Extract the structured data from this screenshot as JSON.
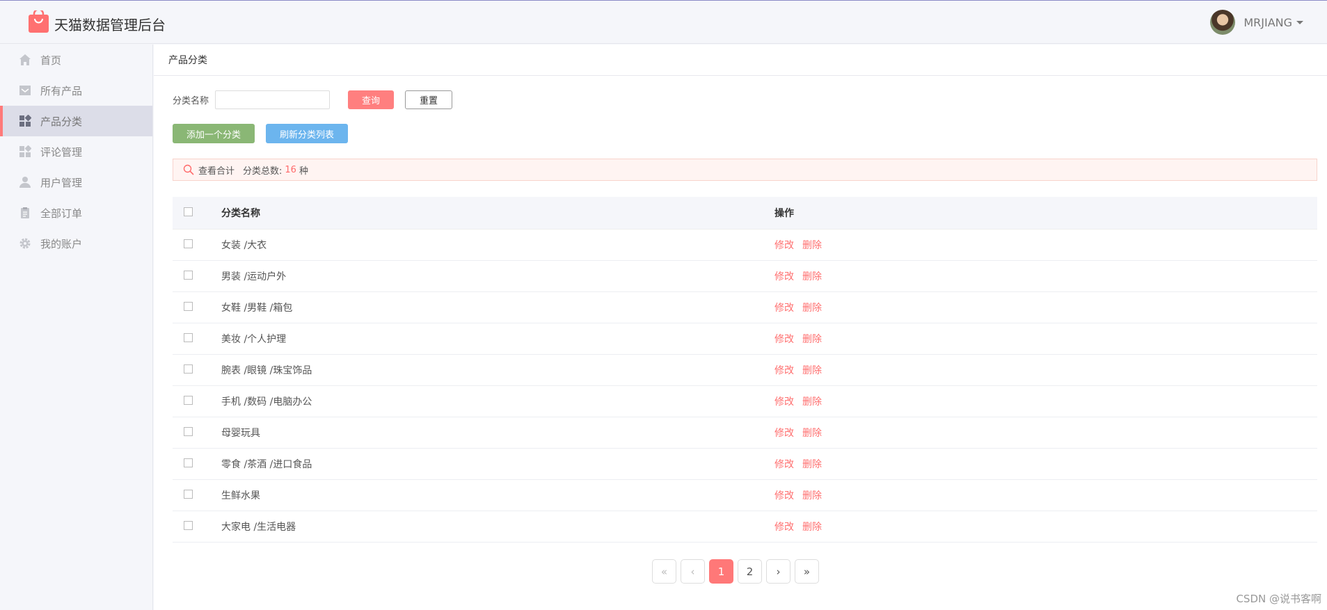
{
  "app": {
    "title": "天猫数据管理后台"
  },
  "user": {
    "name": "MRJIANG"
  },
  "sidebar": {
    "items": [
      {
        "label": "首页",
        "icon": "home-icon"
      },
      {
        "label": "所有产品",
        "icon": "inbox-icon"
      },
      {
        "label": "产品分类",
        "icon": "dashboard-icon",
        "active": true
      },
      {
        "label": "评论管理",
        "icon": "dashboard-icon"
      },
      {
        "label": "用户管理",
        "icon": "user-icon"
      },
      {
        "label": "全部订单",
        "icon": "clipboard-icon"
      },
      {
        "label": "我的账户",
        "icon": "gear-icon"
      }
    ]
  },
  "breadcrumb": {
    "title": "产品分类"
  },
  "filter": {
    "label": "分类名称",
    "input_value": "",
    "query_label": "查询",
    "reset_label": "重置"
  },
  "actions": {
    "add_label": "添加一个分类",
    "refresh_label": "刷新分类列表"
  },
  "summary": {
    "label": "查看合计",
    "count_label": "分类总数:",
    "count": "16",
    "unit": "种"
  },
  "table": {
    "headers": {
      "name": "分类名称",
      "ops": "操作"
    },
    "edit_label": "修改",
    "delete_label": "删除",
    "rows": [
      "女装 /大衣",
      "男装 /运动户外",
      "女鞋 /男鞋 /箱包",
      "美妆 /个人护理",
      "腕表 /眼镜 /珠宝饰品",
      "手机 /数码 /电脑办公",
      "母婴玩具",
      "零食 /茶酒 /进口食品",
      "生鲜水果",
      "大家电 /生活电器"
    ]
  },
  "pagination": {
    "first": "«",
    "prev": "‹",
    "pages": [
      "1",
      "2"
    ],
    "current": "1",
    "next": "›",
    "last": "»"
  },
  "watermark": "CSDN @说书客啊",
  "colors": {
    "accent": "#ff7878",
    "add_button": "#8ab775",
    "refresh_button": "#6cb5ee"
  }
}
